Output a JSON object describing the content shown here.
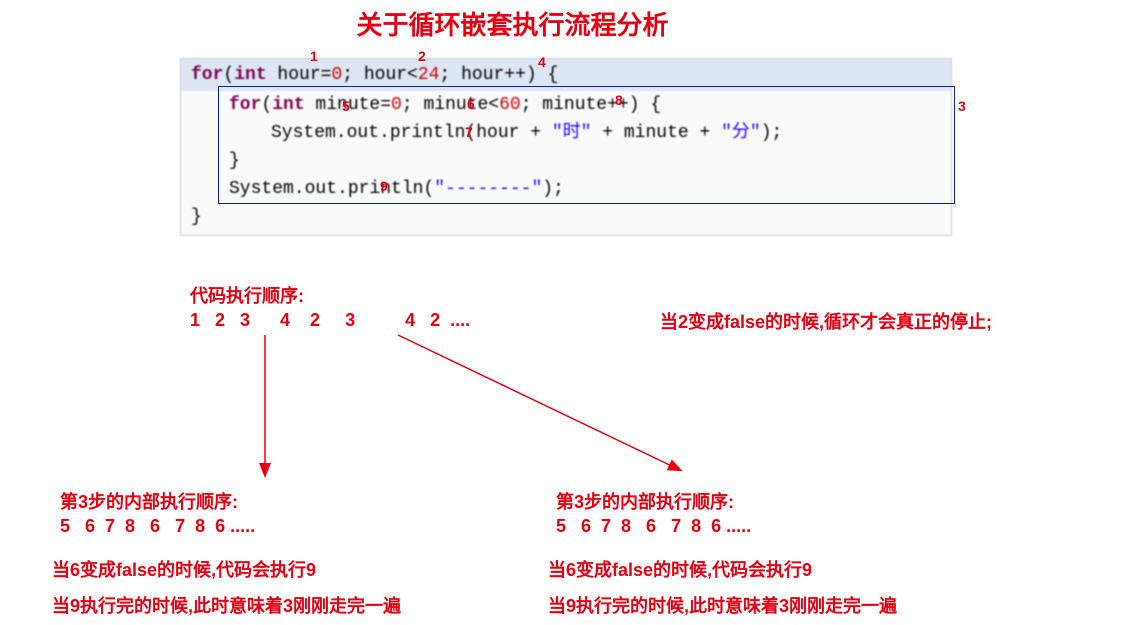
{
  "title": "关于循环嵌套执行流程分析",
  "code": {
    "line1_kw1": "for",
    "line1_kw2": "int",
    "line1_seg1": "(",
    "line1_seg2": " hour=",
    "line1_num1": "0",
    "line1_seg3": "; hour<",
    "line1_num2": "24",
    "line1_seg4": "; hour++) ",
    "line1_brace": "{",
    "line2_kw1": "for",
    "line2_kw2": "int",
    "line2_seg1": "(",
    "line2_seg2": " minute=",
    "line2_num1": "0",
    "line2_seg3": "; minute<",
    "line2_num2": "60",
    "line2_seg4": "; minute++) ",
    "line2_brace": "{",
    "line3_seg1": "System.out.println(hour + ",
    "line3_str1": "\"时\"",
    "line3_seg2": " + minute + ",
    "line3_str2": "\"分\"",
    "line3_seg3": ");",
    "line4_brace": "}",
    "line5_seg1": "System.out.println(",
    "line5_str1": "\"--------\"",
    "line5_seg2": ");",
    "line6_brace": "}"
  },
  "annot": {
    "a1": "1",
    "a2": "2",
    "a3": "3",
    "a4": "4",
    "a5": "5",
    "a6": "6",
    "a7": "7",
    "a8": "8",
    "a9": "9"
  },
  "seq": {
    "title": "代码执行顺序:",
    "nums": "1   2   3      4    2     3          4   2  ....",
    "note": "当2变成false的时候,循环才会真正的停止;"
  },
  "left": {
    "title": "第3步的内部执行顺序:",
    "nums": "5   6  7  8   6   7  8  6 .....",
    "note1": "当6变成false的时候,代码会执行9",
    "note2": "当9执行完的时候,此时意味着3刚刚走完一遍"
  },
  "right": {
    "title": "第3步的内部执行顺序:",
    "nums": "5   6  7  8   6   7  8  6 .....",
    "note1": "当6变成false的时候,代码会执行9",
    "note2": "当9执行完的时候,此时意味着3刚刚走完一遍"
  }
}
